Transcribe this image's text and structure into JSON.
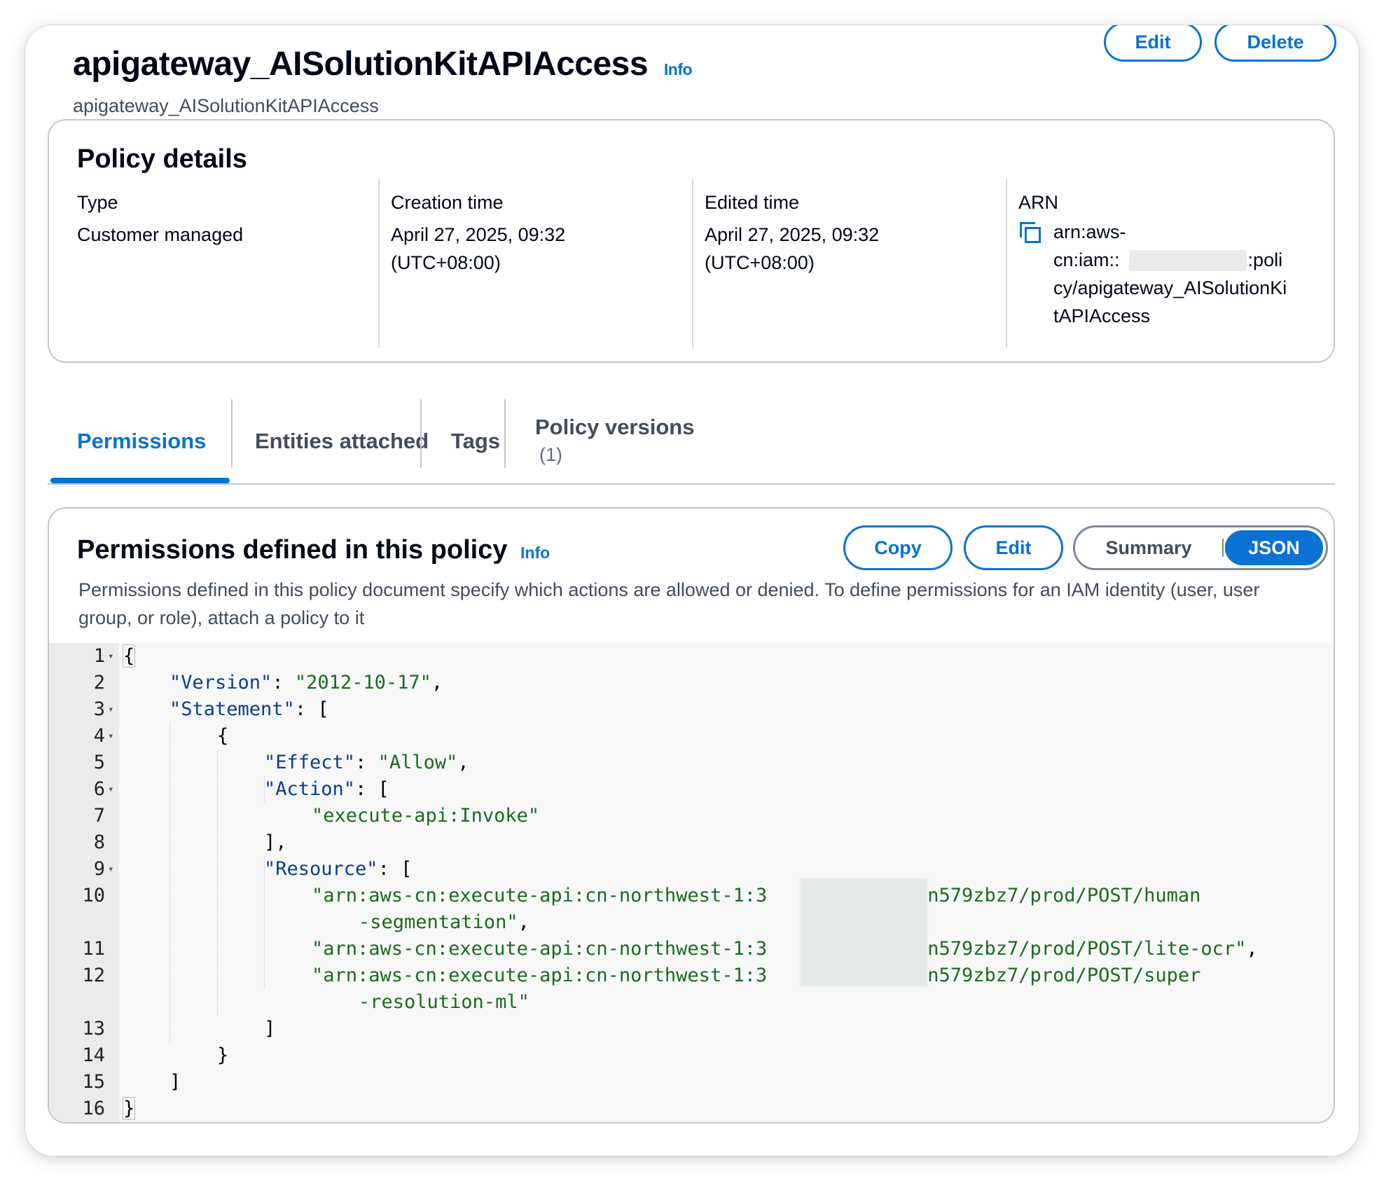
{
  "header": {
    "title": "apigateway_AISolutionKitAPIAccess",
    "info": "Info",
    "subtitle": "apigateway_AISolutionKitAPIAccess",
    "edit_label": "Edit",
    "delete_label": "Delete"
  },
  "details": {
    "heading": "Policy details",
    "type_label": "Type",
    "type_value": "Customer managed",
    "creation_label": "Creation time",
    "creation_value_1": "April 27, 2025, 09:32",
    "creation_value_2": "(UTC+08:00)",
    "edited_label": "Edited time",
    "edited_value_1": "April 27, 2025, 09:32",
    "edited_value_2": "(UTC+08:00)",
    "arn_label": "ARN",
    "arn_line1": "arn:aws-",
    "arn_line2": "cn:iam::",
    "arn_line2_tail": "1:poli",
    "arn_line3": "cy/apigateway_AISolutionKi",
    "arn_line4": "tAPIAccess"
  },
  "tabs": {
    "permissions": "Permissions",
    "entities": "Entities attached",
    "tags": "Tags",
    "versions": "Policy versions",
    "versions_count": "(1)"
  },
  "permissions": {
    "heading": "Permissions defined in this policy",
    "info": "Info",
    "copy_label": "Copy",
    "edit_label": "Edit",
    "summary_label": "Summary",
    "json_label": "JSON",
    "description": "Permissions defined in this policy document specify which actions are allowed or denied. To define permissions for an IAM identity (user, user group, or role), attach a policy to it"
  },
  "editor": {
    "lines": [
      {
        "n": "1",
        "fold": true
      },
      {
        "n": "2"
      },
      {
        "n": "3",
        "fold": true
      },
      {
        "n": "4",
        "fold": true
      },
      {
        "n": "5"
      },
      {
        "n": "6",
        "fold": true
      },
      {
        "n": "7"
      },
      {
        "n": "8"
      },
      {
        "n": "9",
        "fold": true
      },
      {
        "n": "10"
      },
      {
        "n": ""
      },
      {
        "n": "11"
      },
      {
        "n": "12"
      },
      {
        "n": ""
      },
      {
        "n": "13"
      },
      {
        "n": "14"
      },
      {
        "n": "15"
      },
      {
        "n": "16"
      }
    ],
    "code": {
      "l1": "{",
      "l2_key": "\"Version\"",
      "l2_sep": ": ",
      "l2_val": "\"2012-10-17\"",
      "l2_end": ",",
      "l3_key": "\"Statement\"",
      "l3_rest": ": [",
      "l4": "{",
      "l5_key": "\"Effect\"",
      "l5_sep": ": ",
      "l5_val": "\"Allow\"",
      "l5_end": ",",
      "l6_key": "\"Action\"",
      "l6_rest": ": [",
      "l7_val": "\"execute-api:Invoke\"",
      "l8": "],",
      "l9_key": "\"Resource\"",
      "l9_rest": ": [",
      "l10_a": "\"arn:aws-cn:execute-api:cn-northwest-1:3",
      "l10_b": "1:ccn579zbz7/prod/POST/human",
      "l10_c": "-segmentation\"",
      "l10_end": ",",
      "l11_a": "\"arn:aws-cn:execute-api:cn-northwest-1:3",
      "l11_b": "1:ccn579zbz7/prod/POST/lite-ocr\"",
      "l11_end": ",",
      "l12_a": "\"arn:aws-cn:execute-api:cn-northwest-1:3",
      "l12_b": "1:ccn579zbz7/prod/POST/super",
      "l12_c": "-resolution-ml\"",
      "l13": "]",
      "l14": "}",
      "l15": "]",
      "l16": "}"
    }
  }
}
